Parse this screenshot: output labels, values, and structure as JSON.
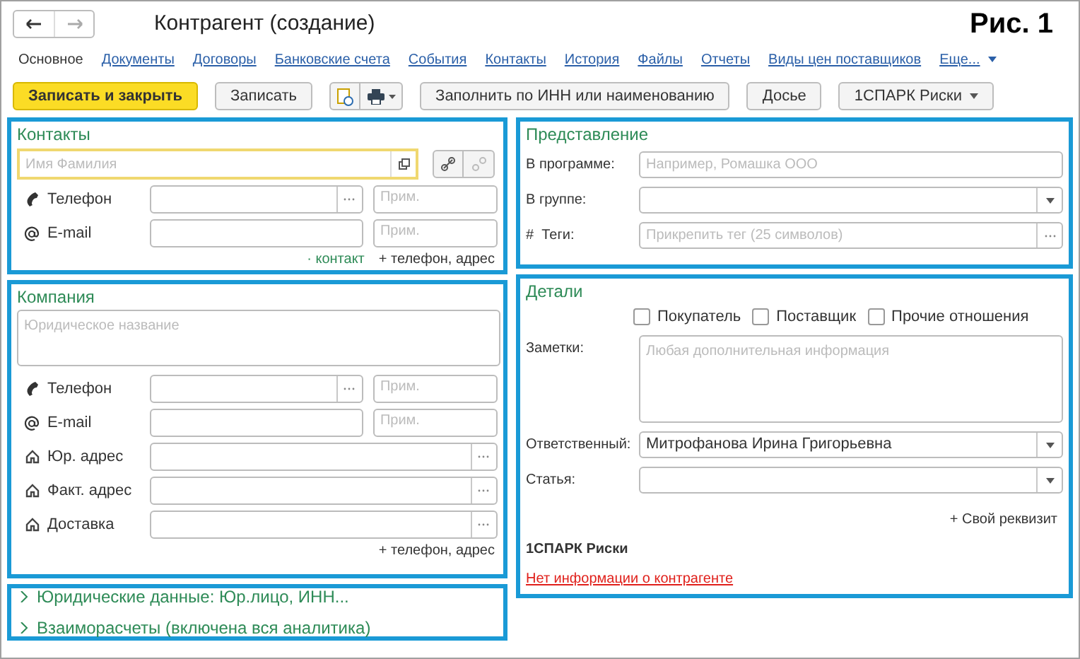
{
  "window": {
    "title": "Контрагент (создание)",
    "figure_label": "Рис. 1"
  },
  "tabs": [
    {
      "label": "Основное",
      "selected": true
    },
    {
      "label": "Документы",
      "selected": false
    },
    {
      "label": "Договоры",
      "selected": false
    },
    {
      "label": "Банковские счета",
      "selected": false
    },
    {
      "label": "События",
      "selected": false
    },
    {
      "label": "Контакты",
      "selected": false
    },
    {
      "label": "История",
      "selected": false
    },
    {
      "label": "Файлы",
      "selected": false
    },
    {
      "label": "Отчеты",
      "selected": false
    },
    {
      "label": "Виды цен поставщиков",
      "selected": false
    },
    {
      "label": "Еще...",
      "selected": false
    }
  ],
  "toolbar": [
    {
      "kind": "primary",
      "label": "Записать и закрыть"
    },
    {
      "kind": "normal",
      "label": "Записать"
    },
    {
      "kind": "icons"
    },
    {
      "kind": "normal",
      "label": "Заполнить по ИНН или наименованию"
    },
    {
      "kind": "normal",
      "label": "Досье"
    },
    {
      "kind": "dropdown",
      "label": "1СПАРК Риски"
    }
  ],
  "contacts": {
    "title": "Контакты",
    "name_placeholder": "Имя Фамилия",
    "rows": [
      {
        "kind": "phone",
        "label": "Телефон",
        "note_placeholder": "Прим."
      },
      {
        "kind": "email",
        "label": "E-mail",
        "note_placeholder": "Прим."
      }
    ],
    "links": [
      {
        "kind": "accent",
        "text": "· контакт"
      },
      {
        "kind": "plain",
        "text": "+ телефон, адрес"
      }
    ]
  },
  "company": {
    "title": "Компания",
    "name_placeholder": "Юридическое название",
    "rows": [
      {
        "kind": "phone",
        "label": "Телефон",
        "note_placeholder": "Прим."
      },
      {
        "kind": "email",
        "label": "E-mail",
        "note_placeholder": "Прим."
      },
      {
        "kind": "address",
        "label": "Юр. адрес"
      },
      {
        "kind": "address",
        "label": "Факт. адрес"
      },
      {
        "kind": "address",
        "label": "Доставка"
      }
    ],
    "links": [
      {
        "kind": "plain",
        "text": "+ телефон, адрес"
      }
    ]
  },
  "sections": [
    {
      "label": "Юридические данные: Юр.лицо, ИНН...",
      "expanded": false
    },
    {
      "label": "Взаиморасчеты (включена вся аналитика)",
      "expanded": false
    }
  ],
  "presentation": {
    "title": "Представление",
    "rows": [
      {
        "kind": "text",
        "label": "В программе:",
        "placeholder": "Например, Ромашка ООО"
      },
      {
        "kind": "dropdown",
        "label": "В группе:"
      },
      {
        "kind": "select",
        "label": "#  Теги:",
        "placeholder": "Прикрепить тег (25 символов)"
      }
    ]
  },
  "details": {
    "title": "Детали",
    "checkboxes": [
      {
        "label": "Покупатель",
        "checked": false
      },
      {
        "label": "Поставщик",
        "checked": false
      },
      {
        "label": "Прочие отношения",
        "checked": false
      }
    ],
    "notes_label": "Заметки:",
    "notes_placeholder": "Любая дополнительная информация",
    "rows": [
      {
        "kind": "dropdown",
        "label": "Ответственный:",
        "value": "Митрофанова Ирина Григорьевна"
      },
      {
        "kind": "dropdown",
        "label": "Статья:"
      }
    ],
    "add_link": "+ Свой реквизит",
    "spark_title": "1СПАРК Риски",
    "spark_link": "Нет информации о контрагенте"
  }
}
